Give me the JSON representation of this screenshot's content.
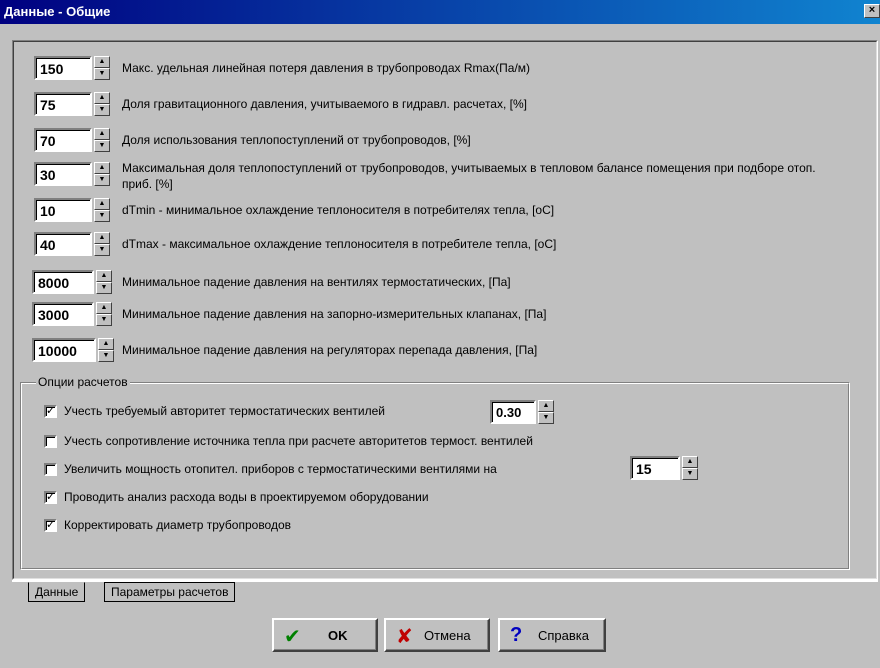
{
  "window": {
    "title": "Данные - Общие",
    "close_label": "×"
  },
  "params": [
    {
      "value": "150",
      "label": "Макс. удельная линейная потеря давления в трубопроводах Rmax(Па/м)"
    },
    {
      "value": "75",
      "label": "Доля гравитационного давления, учитываемого в гидравл. расчетах, [%]"
    },
    {
      "value": "70",
      "label": "Доля использования теплопоступлений от трубопроводов, [%]"
    },
    {
      "value": "30",
      "label": "Максимальная доля теплопоступлений от трубопроводов, учитываемых в тепловом балансе помещения при подборе отоп. приб. [%]"
    },
    {
      "value": "10",
      "label": "dTmin - минимальное охлаждение теплоносителя в потребителях тепла, [oC]"
    },
    {
      "value": "40",
      "label": "dTmax - максимальное охлаждение теплоносителя в потребителе тепла, [oC]"
    },
    {
      "value": "8000",
      "label": "Минимальное падение давления на вентилях термостатических, [Па]"
    },
    {
      "value": "3000",
      "label": "Минимальное падение давления на запорно-измерительных клапанах, [Па]"
    },
    {
      "value": "10000",
      "label": "Минимальное падение давления на регуляторах перепада давления, [Па]"
    }
  ],
  "options": {
    "title": "Опции расчетов",
    "items": [
      {
        "checked": "✓",
        "label": "Учесть требуемый авторитет термостатических вентилей",
        "value": "0.30"
      },
      {
        "checked": "",
        "label": "Учесть сопротивление источника тепла при расчете авторитетов термост. вентилей"
      },
      {
        "checked": "",
        "label": "Увеличить мощность отопител. приборов с термостатическими вентилями на",
        "value": "15"
      },
      {
        "checked": "✓",
        "label": "Проводить анализ расхода воды в проектируемом оборудовании"
      },
      {
        "checked": "✓",
        "label": "Корректировать диаметр трубопроводов"
      }
    ]
  },
  "tabs": [
    "Данные",
    "Параметры расчетов"
  ],
  "buttons": {
    "ok": "OK",
    "cancel": "Отмена",
    "help": "Справка"
  },
  "colors": {
    "ok_icon": "#008000",
    "cancel_icon": "#c00000",
    "help_icon": "#0000c0"
  },
  "icons": {
    "ok": "checkmark-icon",
    "cancel": "cross-icon",
    "help": "question-icon"
  }
}
